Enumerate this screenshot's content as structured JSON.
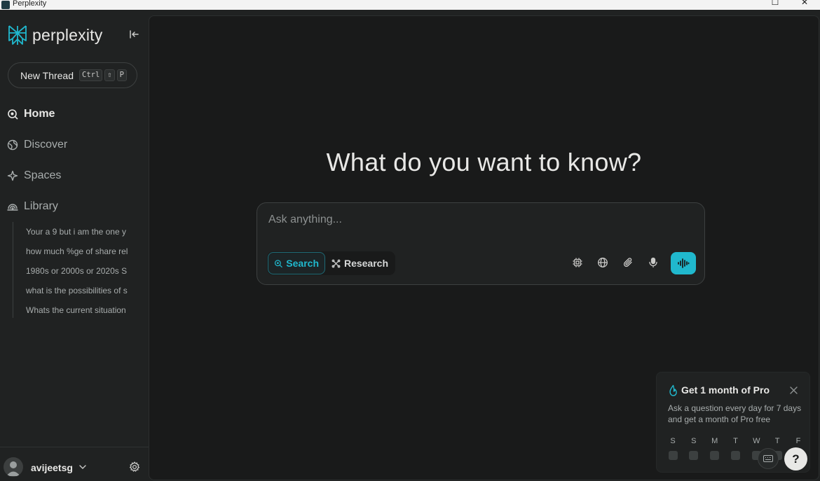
{
  "window": {
    "title": "Perplexity",
    "maximize_glyph": "☐",
    "close_glyph": "✕"
  },
  "sidebar": {
    "logo_text": "perplexity",
    "new_thread": {
      "label": "New Thread",
      "keys": [
        "Ctrl",
        "⇧",
        "P"
      ]
    },
    "nav": [
      {
        "label": "Home",
        "icon": "home-search-icon",
        "active": true
      },
      {
        "label": "Discover",
        "icon": "globe-icon",
        "active": false
      },
      {
        "label": "Spaces",
        "icon": "sparkle-icon",
        "active": false
      },
      {
        "label": "Library",
        "icon": "library-icon",
        "active": false
      }
    ],
    "library_items": [
      "Your a 9 but i am the one y",
      "how much %ge of share rel",
      "1980s or 2000s or 2020s S",
      "what is the possibilities of s",
      "Whats the current situation"
    ],
    "user": {
      "name": "avijeetsg"
    }
  },
  "main": {
    "headline": "What do you want to know?",
    "ask": {
      "placeholder": "Ask anything...",
      "value": "",
      "modes": [
        {
          "label": "Search",
          "icon": "search-icon",
          "selected": true
        },
        {
          "label": "Research",
          "icon": "research-icon",
          "selected": false
        }
      ],
      "tools": [
        "model-chip-icon",
        "globe-icon",
        "paperclip-icon",
        "microphone-icon"
      ],
      "voice_button_icon": "voice-wave-icon"
    }
  },
  "promo": {
    "title": "Get 1 month of Pro",
    "body": "Ask a question every day for 7 days and get a month of Pro free",
    "days": [
      "S",
      "S",
      "M",
      "T",
      "W",
      "T",
      "F"
    ]
  },
  "help": {
    "label": "?"
  },
  "colors": {
    "accent": "#20b8cd",
    "background": "#191a1a",
    "sidebar": "#202222"
  }
}
